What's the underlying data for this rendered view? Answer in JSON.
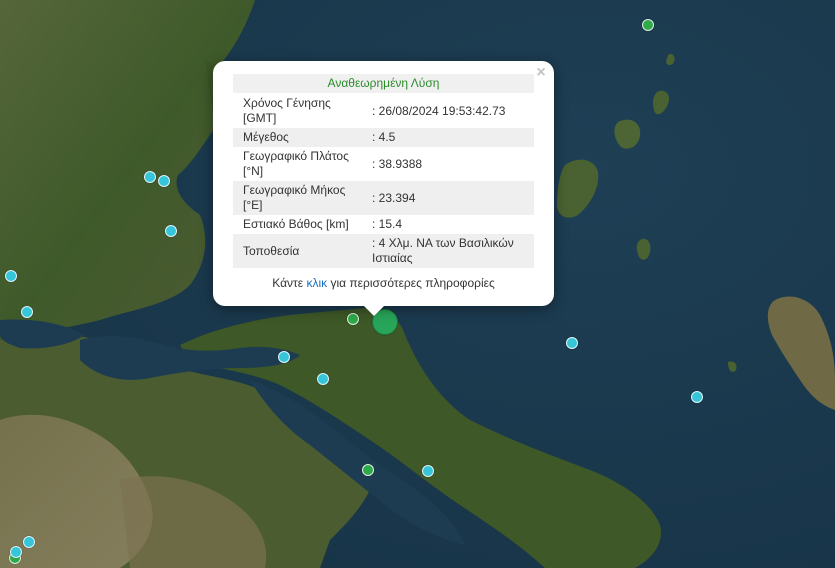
{
  "map": {
    "colors": {
      "sea": "#1b3a4f",
      "land": "#4a5e2e",
      "forest": "#2f4a20",
      "dry": "#8a7f5c"
    },
    "markers": [
      {
        "color": "#27a559",
        "size": "large",
        "selected": true
      },
      {
        "color": "#2faa4a",
        "size": "small"
      },
      {
        "color": "#2faa4a",
        "size": "small"
      },
      {
        "color": "#2faa4a",
        "size": "small"
      },
      {
        "color": "#2faa4a",
        "size": "small"
      },
      {
        "color": "#36c5d9",
        "size": "small"
      },
      {
        "color": "#36c5d9",
        "size": "small"
      },
      {
        "color": "#36c5d9",
        "size": "small"
      },
      {
        "color": "#36c5d9",
        "size": "small"
      },
      {
        "color": "#36c5d9",
        "size": "small"
      },
      {
        "color": "#36c5d9",
        "size": "small"
      },
      {
        "color": "#36c5d9",
        "size": "small"
      },
      {
        "color": "#36c5d9",
        "size": "small"
      },
      {
        "color": "#36c5d9",
        "size": "small"
      },
      {
        "color": "#36c5d9",
        "size": "small"
      },
      {
        "color": "#36c5d9",
        "size": "small"
      },
      {
        "color": "#36c5d9",
        "size": "small"
      }
    ]
  },
  "popup": {
    "close_icon": "×",
    "title": "Αναθεωρημένη Λύση",
    "rows": [
      {
        "key": "Χρόνος Γένησης [GMT]",
        "value": ": 26/08/2024 19:53:42.73"
      },
      {
        "key": "Μέγεθος",
        "value": ": 4.5"
      },
      {
        "key": "Γεωγραφικό Πλάτος [°N]",
        "value": ": 38.9388"
      },
      {
        "key": "Γεωγραφικό Μήκος [°E]",
        "value": ": 23.394"
      },
      {
        "key": "Εστιακό Βάθος [km]",
        "value": ": 15.4"
      },
      {
        "key": "Τοποθεσία",
        "value": ": 4 Χλμ. ΝΑ των Βασιλικών Ιστιαίας"
      }
    ],
    "more_prefix": "Κάντε ",
    "more_link": "κλικ",
    "more_suffix": " για περισσότερες πληροφορίες"
  }
}
